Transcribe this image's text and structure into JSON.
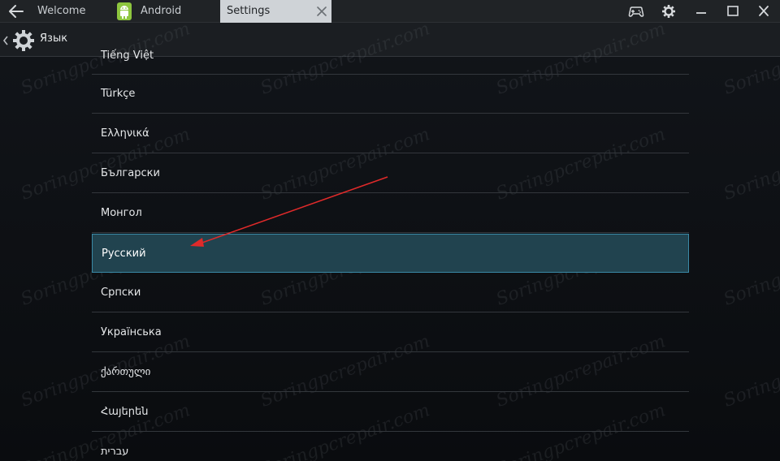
{
  "topbar": {
    "tabs": [
      {
        "label": "Welcome"
      },
      {
        "label": "Android"
      },
      {
        "label": "Settings"
      }
    ]
  },
  "actionbar": {
    "title": "Язык"
  },
  "languages": [
    {
      "label": "Tiếng Việt",
      "partial": true
    },
    {
      "label": "Türkçe"
    },
    {
      "label": "Ελληνικά"
    },
    {
      "label": "Български"
    },
    {
      "label": "Монгол"
    },
    {
      "label": "Русский",
      "selected": true
    },
    {
      "label": "Српски"
    },
    {
      "label": "Українська"
    },
    {
      "label": "ქართული"
    },
    {
      "label": "Հայերեն"
    },
    {
      "label": "עברית"
    }
  ],
  "watermark": {
    "text": "Soringpcrepair.com"
  },
  "colors": {
    "selected_bg": "#21434f",
    "selected_border": "#3a8aa7",
    "arrow": "#e02a2a",
    "android_green": "#8ec63f"
  },
  "icons": {
    "back": "back-arrow-icon",
    "android": "android-icon",
    "close": "close-icon",
    "gamepad": "gamepad-icon",
    "gear": "gear-icon",
    "minimize": "minimize-icon",
    "maximize": "maximize-icon",
    "window_close": "window-close-icon",
    "settings_up": "settings-gear-icon"
  }
}
